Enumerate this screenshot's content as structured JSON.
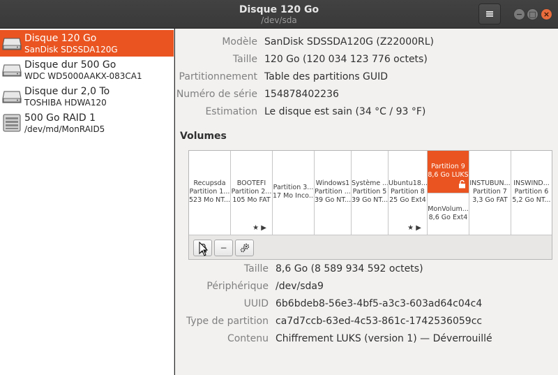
{
  "window": {
    "title": "Disque 120 Go",
    "subtitle": "/dev/sda",
    "menu_icon": "hamburger-menu-icon",
    "minimize_glyph": "−",
    "maximize_glyph": "□",
    "close_glyph": "×"
  },
  "sidebar": {
    "drives": [
      {
        "name": "Disque 120 Go",
        "sub": "SanDisk SDSSDA120G",
        "icon": "hard-disk-icon",
        "selected": true
      },
      {
        "name": "Disque dur 500 Go",
        "sub": "WDC WD5000AAKX-083CA1",
        "icon": "hard-disk-icon",
        "selected": false
      },
      {
        "name": "Disque dur 2,0 To",
        "sub": "TOSHIBA HDWA120",
        "icon": "hard-disk-icon",
        "selected": false
      },
      {
        "name": "500 Go RAID 1",
        "sub": "/dev/md/MonRAID5",
        "icon": "raid-array-icon",
        "selected": false
      }
    ]
  },
  "disk": {
    "model_label": "Modèle",
    "model": "SanDisk SDSSDA120G (Z22000RL)",
    "size_label": "Taille",
    "size": "120 Go (120 034 123 776 octets)",
    "partitioning_label": "Partitionnement",
    "partitioning": "Table des partitions GUID",
    "serial_label": "Numéro de série",
    "serial": "154878402236",
    "assessment_label": "Estimation",
    "assessment": "Le disque est sain (34 °C / 93 °F)"
  },
  "volumes": {
    "heading": "Volumes",
    "segments": [
      {
        "l1": "Recupsda",
        "l2": "Partition 1...",
        "l3": "523 Mo NT..."
      },
      {
        "l1": "BOOTEFI",
        "l2": "Partition 2...",
        "l3": "105 Mo FAT",
        "marks": "★ ▶"
      },
      {
        "l1": "Partition 3...",
        "l2": "17 Mo Inco..."
      },
      {
        "l1": "Windows1",
        "l2": "Partition ...",
        "l3": "39 Go NT..."
      },
      {
        "l1": "Système ...",
        "l2": "Partition 5",
        "l3": "39 Go NT..."
      },
      {
        "l1": "Ubuntu18...",
        "l2": "Partition 8",
        "l3": "25 Go Ext4",
        "marks": "★ ▶"
      },
      {
        "l1": "Partition 9",
        "l2": "8,6 Go LUKS",
        "sub1": "MonVolum...",
        "sub2": "8,6 Go Ext4",
        "lock_icon": "unlocked-padlock-icon"
      },
      {
        "l1": "INSTUBUN...",
        "l2": "Partition 7",
        "l3": "3,3 Go FAT"
      },
      {
        "l1": "INSWIND...",
        "l2": "Partition 6",
        "l3": "5,2 Go NT..."
      }
    ],
    "toolbar": {
      "lock_icon": "lock-icon",
      "remove_glyph": "−",
      "settings_icon": "gears-icon"
    }
  },
  "partition": {
    "size_label": "Taille",
    "size": "8,6 Go (8 589 934 592 octets)",
    "device_label": "Périphérique",
    "device": "/dev/sda9",
    "uuid_label": "UUID",
    "uuid": "6b6bdeb8-56e3-4bf5-a3c3-603ad64c04c4",
    "type_label": "Type de partition",
    "type": "ca7d7ccb-63ed-4c53-861c-1742536059cc",
    "contents_label": "Contenu",
    "contents": "Chiffrement LUKS (version 1) — Déverrouillé"
  }
}
